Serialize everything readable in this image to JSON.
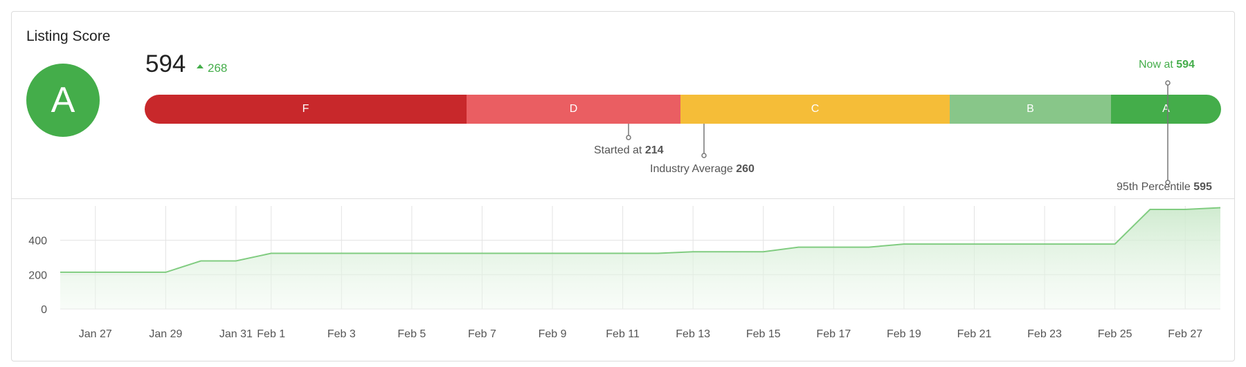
{
  "card": {
    "title": "Listing Score"
  },
  "grade": {
    "letter": "A"
  },
  "score": {
    "value": "594",
    "delta": "268"
  },
  "grade_bar": {
    "segments": [
      {
        "label": "F",
        "color": "#c8282b"
      },
      {
        "label": "D",
        "color": "#ea5e62"
      },
      {
        "label": "C",
        "color": "#f5bd38"
      },
      {
        "label": "B",
        "color": "#88c689"
      },
      {
        "label": "A",
        "color": "#44ad4a"
      }
    ]
  },
  "markers": {
    "now": {
      "text": "Now at",
      "value": "594"
    },
    "started": {
      "text": "Started at",
      "value": "214"
    },
    "industry": {
      "text": "Industry Average",
      "value": "260"
    },
    "percentile": {
      "text": "95th Percentile",
      "value": "595"
    }
  },
  "colors": {
    "accent": "#44ad4a",
    "line": "#80cc80"
  },
  "chart_data": {
    "type": "area",
    "x": [
      "Jan 26",
      "Jan 27",
      "Jan 28",
      "Jan 29",
      "Jan 30",
      "Jan 31",
      "Feb 1",
      "Feb 2",
      "Feb 3",
      "Feb 4",
      "Feb 5",
      "Feb 6",
      "Feb 7",
      "Feb 8",
      "Feb 9",
      "Feb 10",
      "Feb 11",
      "Feb 12",
      "Feb 13",
      "Feb 14",
      "Feb 15",
      "Feb 16",
      "Feb 17",
      "Feb 18",
      "Feb 19",
      "Feb 20",
      "Feb 21",
      "Feb 22",
      "Feb 23",
      "Feb 24",
      "Feb 25",
      "Feb 26",
      "Feb 27",
      "Feb 28"
    ],
    "values": [
      214,
      214,
      214,
      214,
      280,
      280,
      324,
      324,
      324,
      324,
      324,
      324,
      324,
      324,
      324,
      324,
      324,
      324,
      333,
      333,
      333,
      360,
      360,
      360,
      378,
      378,
      378,
      378,
      378,
      378,
      378,
      580,
      580,
      590
    ],
    "xticks": [
      "Jan 27",
      "Jan 29",
      "Jan 31",
      "Feb 1",
      "Feb 3",
      "Feb 5",
      "Feb 7",
      "Feb 9",
      "Feb 11",
      "Feb 13",
      "Feb 15",
      "Feb 17",
      "Feb 19",
      "Feb 21",
      "Feb 23",
      "Feb 25",
      "Feb 27"
    ],
    "yticks": [
      "0",
      "200",
      "400"
    ],
    "ylim": [
      0,
      600
    ],
    "grid": true
  }
}
